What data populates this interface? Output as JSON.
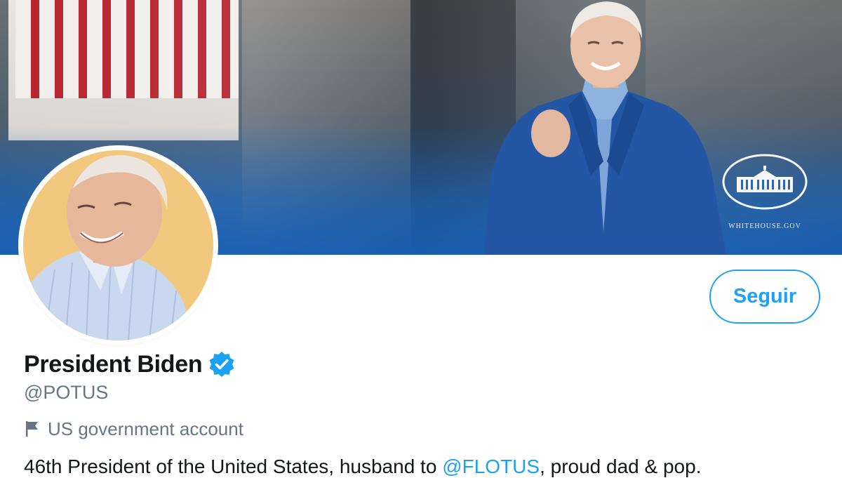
{
  "banner": {
    "logo_icon": "white-house-icon",
    "logo_text": "WHITEHOUSE.GOV"
  },
  "profile": {
    "display_name": "President Biden",
    "verified_icon": "verified-badge-icon",
    "handle": "@POTUS",
    "label_icon": "flag-icon",
    "label": "US government account",
    "bio_start": "46th President of the United States, husband to ",
    "bio_mention": "@FLOTUS",
    "bio_end": ", proud dad & pop."
  },
  "actions": {
    "follow_label": "Seguir"
  },
  "colors": {
    "accent": "#1da1f2",
    "text_primary": "#14171a",
    "text_secondary": "#657786",
    "banner_blue": "#1f63b4",
    "avatar_bg": "#f2c77e"
  }
}
